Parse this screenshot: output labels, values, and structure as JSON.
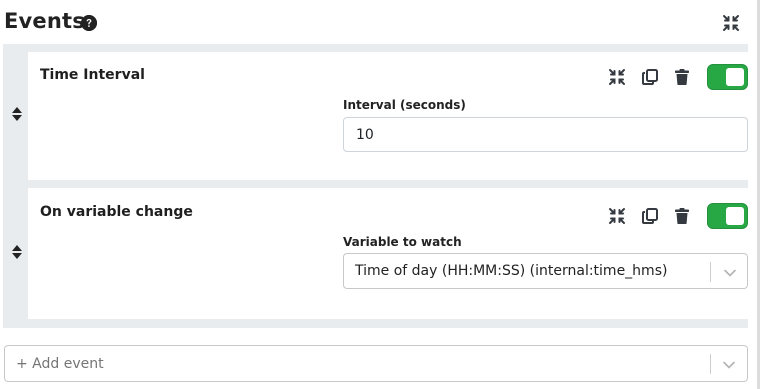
{
  "section": {
    "title": "Events",
    "help_icon": "question-circle-icon",
    "collapse_icon": "compress-icon"
  },
  "events": [
    {
      "name": "Time Interval",
      "enabled": true,
      "field_label": "Interval (seconds)",
      "field_value": "10",
      "field_type": "text"
    },
    {
      "name": "On variable change",
      "enabled": true,
      "field_label": "Variable to watch",
      "field_value": "Time of day (HH:MM:SS) (internal:time_hms)",
      "field_type": "select"
    }
  ],
  "add_event": {
    "placeholder": "+ Add event"
  },
  "colors": {
    "toggle_on": "#28a745",
    "icon": "#343a40",
    "panel_bg": "#e9ecef"
  }
}
